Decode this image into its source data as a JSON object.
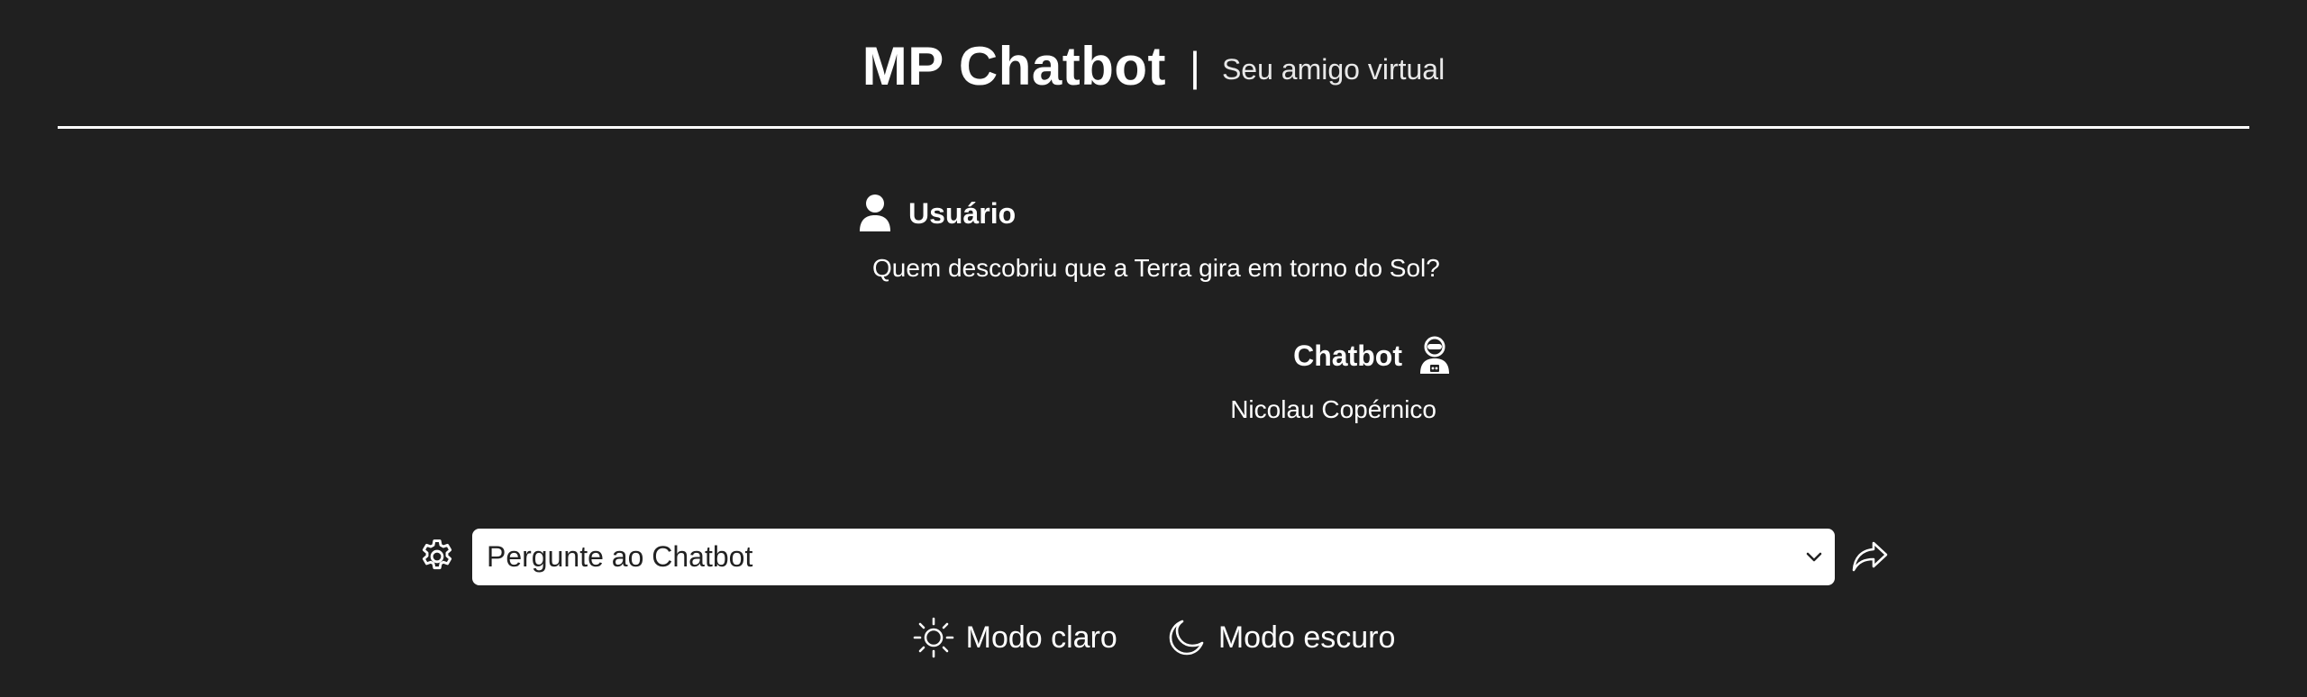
{
  "header": {
    "title": "MP Chatbot",
    "separator": "|",
    "subtitle": "Seu amigo virtual"
  },
  "conversation": {
    "user": {
      "name": "Usuário",
      "icon": "user-icon",
      "message": "Quem descobriu que a Terra gira em torno do Sol?"
    },
    "bot": {
      "name": "Chatbot",
      "icon": "robot-icon",
      "message": "Nicolau Copérnico"
    }
  },
  "input": {
    "selected": "Pergunte ao Chatbot",
    "settings_icon": "gear-icon",
    "send_icon": "share-arrow-icon",
    "dropdown_icon": "chevron-down-icon"
  },
  "theme": {
    "light_label": "Modo claro",
    "light_icon": "sun-icon",
    "dark_label": "Modo escuro",
    "dark_icon": "moon-icon"
  },
  "colors": {
    "background": "#202020",
    "text": "#ffffff",
    "input_background": "#ffffff"
  }
}
